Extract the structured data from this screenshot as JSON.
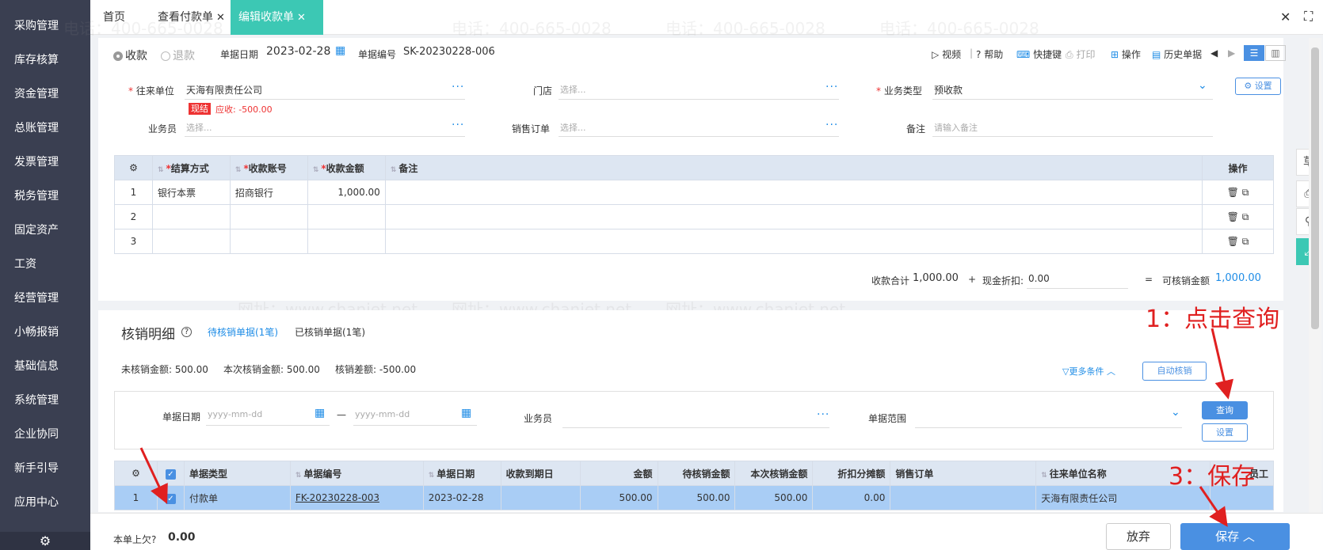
{
  "sidebar": {
    "items": [
      "采购管理",
      "库存核算",
      "资金管理",
      "总账管理",
      "发票管理",
      "税务管理",
      "固定资产",
      "工资",
      "经营管理",
      "小畅报销",
      "基础信息",
      "系统管理",
      "企业协同",
      "新手引导",
      "应用中心"
    ]
  },
  "tabs": [
    {
      "label": "首页"
    },
    {
      "label": "查看付款单"
    },
    {
      "label": "编辑收款单"
    }
  ],
  "window": {
    "close": "✕",
    "fullscreen": "⛶"
  },
  "header": {
    "radio_receive": "收款",
    "radio_refund": "退款",
    "date_label": "单据日期",
    "date_value": "2023-02-28",
    "no_label": "单据编号",
    "no_value": "SK-20230228-006",
    "toolbar": {
      "video": "视频",
      "help": "帮助",
      "shortcut": "快捷键",
      "print": "打印",
      "operate": "操作",
      "history": "历史单据"
    }
  },
  "form": {
    "partner_label": "往来单位",
    "partner_value": "天海有限责任公司",
    "cash_tag": "现结",
    "receivable": "应收: -500.00",
    "store_label": "门店",
    "store_ph": "选择...",
    "biz_type_label": "业务类型",
    "biz_type_value": "预收款",
    "settings_btn": "设置",
    "salesman_label": "业务员",
    "salesman_ph": "选择...",
    "sales_order_label": "销售订单",
    "sales_order_ph": "选择...",
    "remark_label": "备注",
    "remark_ph": "请输入备注"
  },
  "detail_table": {
    "headers": [
      "结算方式",
      "收款账号",
      "收款金额",
      "备注",
      "操作"
    ],
    "rows": [
      {
        "no": "1",
        "method": "银行本票",
        "account": "招商银行",
        "amount": "1,000.00",
        "note": ""
      },
      {
        "no": "2",
        "method": "",
        "account": "",
        "amount": "",
        "note": ""
      },
      {
        "no": "3",
        "method": "",
        "account": "",
        "amount": "",
        "note": ""
      }
    ]
  },
  "totals": {
    "sum_label": "收款合计",
    "sum_value": "1,000.00",
    "plus": "+",
    "discount_label": "现金折扣:",
    "discount_value": "0.00",
    "eq": "=",
    "writeoff_label": "可核销金额",
    "writeoff_value": "1,000.00"
  },
  "writeoff": {
    "title": "核销明细",
    "tab_pending": "待核销单据(1笔)",
    "tab_done": "已核销单据(1笔)",
    "unwritten": "未核销金额: 500.00",
    "this_time": "本次核销金额: 500.00",
    "diff": "核销差额: -500.00",
    "more": "更多条件",
    "auto_btn": "自动核销",
    "filter_date_label": "单据日期",
    "filter_date_from": "yyyy-mm-dd",
    "filter_date_to": "yyyy-mm-dd",
    "dash": "—",
    "filter_salesman_label": "业务员",
    "filter_range_label": "单据范围",
    "query_btn": "查询",
    "set_btn": "设置",
    "table": {
      "headers": [
        "单据类型",
        "单据编号",
        "单据日期",
        "收款到期日",
        "金额",
        "待核销金额",
        "本次核销金额",
        "折扣分摊额",
        "销售订单",
        "往来单位名称",
        "员工"
      ],
      "rows": [
        {
          "no": "1",
          "type": "付款单",
          "code": "FK-20230228-003",
          "date": "2023-02-28",
          "due": "",
          "amount": "500.00",
          "pending": "500.00",
          "this": "500.00",
          "discount": "0.00",
          "order": "",
          "partner": "天海有限责任公司"
        }
      ]
    }
  },
  "footer": {
    "owed_label": "本单上欠",
    "owed_value": "0.00",
    "discard_btn": "放弃",
    "save_btn": "保存"
  },
  "annotations": {
    "step1": "1：点击查询",
    "step3": "3：保存"
  },
  "watermark": {
    "phone": "电话：400-665-0028",
    "site": "网址：www.chanjet.net"
  },
  "colors": {
    "sidebar": "#3a3f51",
    "active_tab": "#3cc8b4",
    "primary_blue": "#4a90e2",
    "annotation_red": "#e02020",
    "selected_row": "#a9cdf5"
  }
}
